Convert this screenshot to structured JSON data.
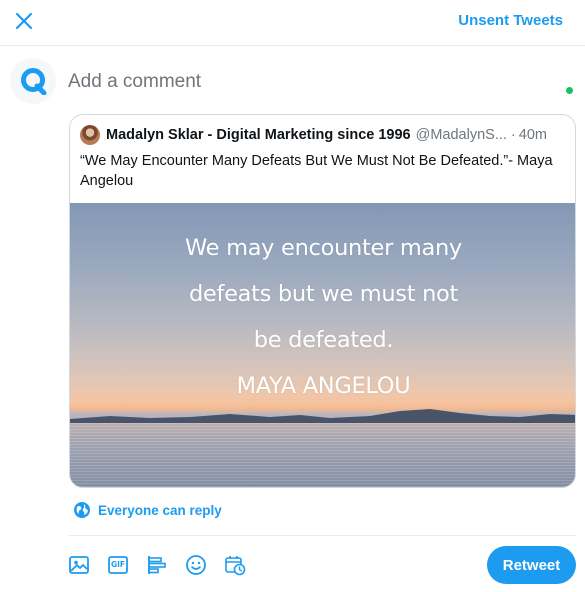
{
  "header": {
    "close_icon": "close-icon",
    "unsent_label": "Unsent Tweets"
  },
  "composer": {
    "avatar_icon": "app-logo-icon",
    "placeholder": "Add a comment",
    "value": ""
  },
  "quoted_tweet": {
    "author_name": "Madalyn Sklar - Digital Marketing since 1996",
    "author_handle": "@MadalynS...",
    "separator": "·",
    "time": "40m",
    "text": "“We May Encounter Many Defeats But We Must Not Be Defeated.”- Maya Angelou",
    "image_text": [
      "We may encounter many",
      "defeats but we must not",
      "be defeated.",
      "MAYA ANGELOU"
    ]
  },
  "reply_setting": {
    "icon": "globe-icon",
    "label": "Everyone can reply"
  },
  "toolbar": {
    "icons": [
      "image-icon",
      "gif-icon",
      "poll-icon",
      "emoji-icon",
      "schedule-icon"
    ],
    "gif_label": "GIF",
    "retweet_label": "Retweet"
  },
  "colors": {
    "accent": "#1d9bf0",
    "status_dot": "#17bf63",
    "border": "#cfd9de",
    "muted_text": "#6e767d"
  }
}
